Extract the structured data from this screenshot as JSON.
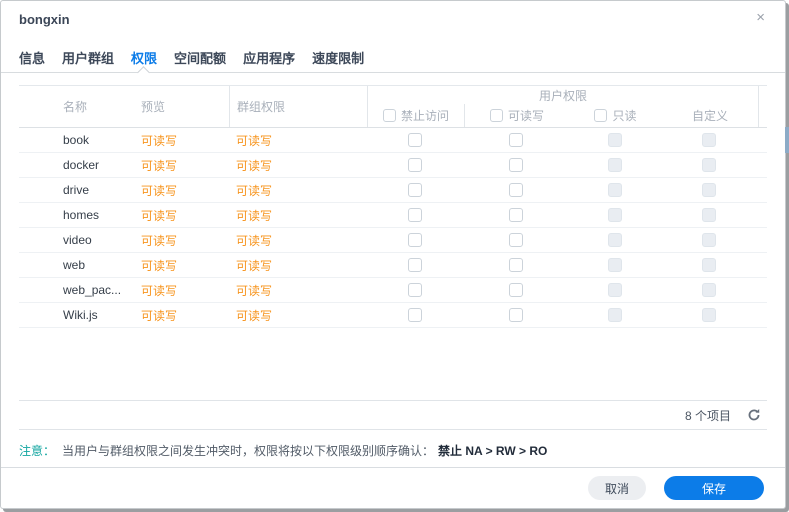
{
  "window": {
    "title": "bongxin"
  },
  "icons": {
    "close": "×",
    "refresh": "circular-arrow"
  },
  "tabs": [
    {
      "key": "info",
      "label": "信息",
      "active": false
    },
    {
      "key": "user-groups",
      "label": "用户群组",
      "active": false
    },
    {
      "key": "permissions",
      "label": "权限",
      "active": true
    },
    {
      "key": "quota",
      "label": "空间配额",
      "active": false
    },
    {
      "key": "applications",
      "label": "应用程序",
      "active": false
    },
    {
      "key": "speed-limit",
      "label": "速度限制",
      "active": false
    }
  ],
  "table": {
    "columns": {
      "name": "名称",
      "preview": "预览",
      "group_permission": "群组权限",
      "user_permission_group": "用户权限",
      "no_access": "禁止访问",
      "read_write": "可读写",
      "read_only": "只读",
      "custom": "自定义"
    },
    "header_checkboxes": {
      "no_access_checked": false,
      "read_write_checked": false,
      "read_only_checked": false
    },
    "rows": [
      {
        "name": "book",
        "preview": "可读写",
        "group_permission": "可读写",
        "no_access": false,
        "read_write": false,
        "read_only": false,
        "custom": false,
        "read_only_disabled": true,
        "custom_disabled": true
      },
      {
        "name": "docker",
        "preview": "可读写",
        "group_permission": "可读写",
        "no_access": false,
        "read_write": false,
        "read_only": false,
        "custom": false,
        "read_only_disabled": true,
        "custom_disabled": true
      },
      {
        "name": "drive",
        "preview": "可读写",
        "group_permission": "可读写",
        "no_access": false,
        "read_write": false,
        "read_only": false,
        "custom": false,
        "read_only_disabled": true,
        "custom_disabled": true
      },
      {
        "name": "homes",
        "preview": "可读写",
        "group_permission": "可读写",
        "no_access": false,
        "read_write": false,
        "read_only": false,
        "custom": false,
        "read_only_disabled": true,
        "custom_disabled": true
      },
      {
        "name": "video",
        "preview": "可读写",
        "group_permission": "可读写",
        "no_access": false,
        "read_write": false,
        "read_only": false,
        "custom": false,
        "read_only_disabled": true,
        "custom_disabled": true
      },
      {
        "name": "web",
        "preview": "可读写",
        "group_permission": "可读写",
        "no_access": false,
        "read_write": false,
        "read_only": false,
        "custom": false,
        "read_only_disabled": true,
        "custom_disabled": true
      },
      {
        "name": "web_pac...",
        "preview": "可读写",
        "group_permission": "可读写",
        "no_access": false,
        "read_write": false,
        "read_only": false,
        "custom": false,
        "read_only_disabled": true,
        "custom_disabled": true
      },
      {
        "name": "Wiki.js",
        "preview": "可读写",
        "group_permission": "可读写",
        "no_access": false,
        "read_write": false,
        "read_only": false,
        "custom": false,
        "read_only_disabled": true,
        "custom_disabled": true
      }
    ]
  },
  "status": {
    "item_count": "8 个项目"
  },
  "note": {
    "label": "注意：",
    "text": "当用户与群组权限之间发生冲突时，权限将按以下权限级别顺序确认：",
    "emphasis": "禁止 NA > RW > RO"
  },
  "actions": {
    "cancel": "取消",
    "save": "保存"
  },
  "colors": {
    "accent_blue": "#0c7ce8",
    "permission_orange": "#f7941d",
    "note_teal": "#12a5a0"
  }
}
